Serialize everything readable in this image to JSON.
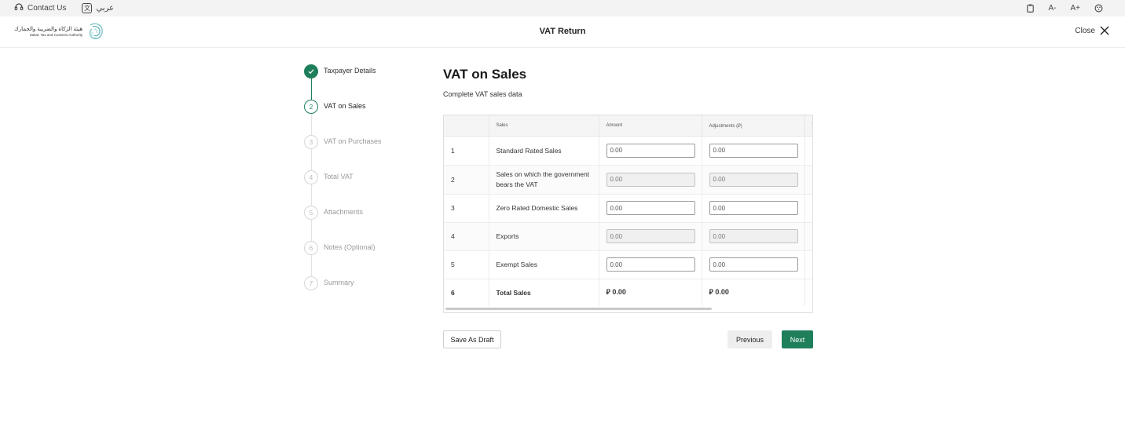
{
  "utility_bar": {
    "contact_us": "Contact Us",
    "language": "عربي",
    "icons": [
      "clipboard-icon",
      "text-smaller-icon",
      "text-larger-icon",
      "contrast-icon"
    ],
    "font_decrease": "A-",
    "font_increase": "A+"
  },
  "header": {
    "logo_ar": "هيئة الزكاة والضريبة والجمارك",
    "logo_en": "Zakat, Tax and Customs Authority",
    "title": "VAT Return",
    "close_label": "Close"
  },
  "stepper": {
    "steps": [
      {
        "number": "1",
        "label": "Taxpayer Details",
        "state": "done"
      },
      {
        "number": "2",
        "label": "VAT on Sales",
        "state": "active"
      },
      {
        "number": "3",
        "label": "VAT on Purchases",
        "state": "todo"
      },
      {
        "number": "4",
        "label": "Total VAT",
        "state": "todo"
      },
      {
        "number": "5",
        "label": "Attachments",
        "state": "todo"
      },
      {
        "number": "6",
        "label": "Notes (Optional)",
        "state": "todo"
      },
      {
        "number": "7",
        "label": "Summary",
        "state": "todo"
      }
    ]
  },
  "main": {
    "title": "VAT on Sales",
    "subtitle": "Complete VAT sales data",
    "table": {
      "headers": [
        "",
        "Sales",
        "Amount",
        "Adjustments (⃁)",
        "V"
      ],
      "rows": [
        {
          "index": "1",
          "sales": "Standard Rated Sales",
          "amount": "0.00",
          "adjustments": "0.00",
          "amount_disabled": false,
          "adj_disabled": false
        },
        {
          "index": "2",
          "sales": "Sales on which the government bears the VAT",
          "amount": "0.00",
          "adjustments": "0.00",
          "amount_disabled": true,
          "adj_disabled": true
        },
        {
          "index": "3",
          "sales": "Zero Rated Domestic Sales",
          "amount": "0.00",
          "adjustments": "0.00",
          "amount_disabled": false,
          "adj_disabled": false
        },
        {
          "index": "4",
          "sales": "Exports",
          "amount": "0.00",
          "adjustments": "0.00",
          "amount_disabled": true,
          "adj_disabled": true
        },
        {
          "index": "5",
          "sales": "Exempt Sales",
          "amount": "0.00",
          "adjustments": "0.00",
          "amount_disabled": false,
          "adj_disabled": false
        },
        {
          "index": "6",
          "sales": "Total Sales",
          "amount": "⃁ 0.00",
          "adjustments": "⃁ 0.00"
        }
      ]
    }
  },
  "actions": {
    "save_draft": "Save As Draft",
    "previous": "Previous",
    "next": "Next"
  },
  "colors": {
    "accent": "#1e7f5a",
    "muted": "#9a9a9a"
  }
}
